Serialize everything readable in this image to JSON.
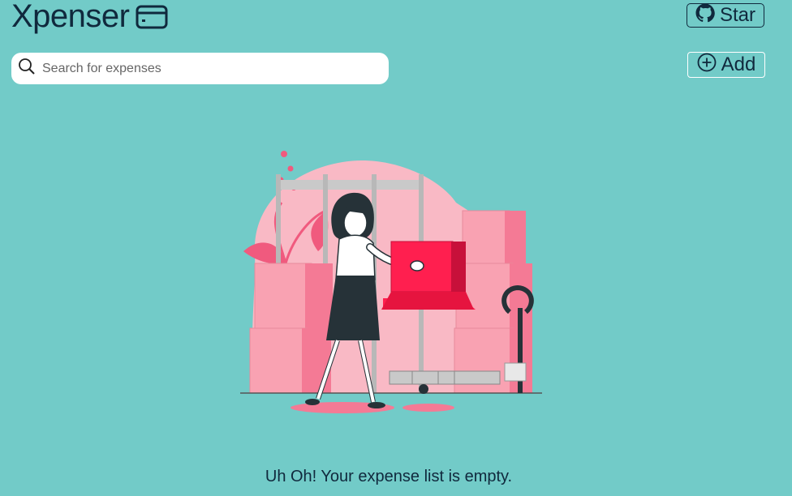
{
  "header": {
    "title": "Xpenser",
    "star_label": "Star",
    "add_label": "Add"
  },
  "search": {
    "placeholder": "Search for expenses",
    "value": ""
  },
  "empty_state": {
    "message": "Uh Oh! Your expense list is empty."
  },
  "icons": {
    "brand": "credit-card-icon",
    "star": "github-icon",
    "add": "plus-circle-icon",
    "search": "search-icon"
  },
  "colors": {
    "background": "#72cbc8",
    "text": "#10293d",
    "accent_pink": "#f4a6b4",
    "accent_red": "#ff1f4f"
  }
}
